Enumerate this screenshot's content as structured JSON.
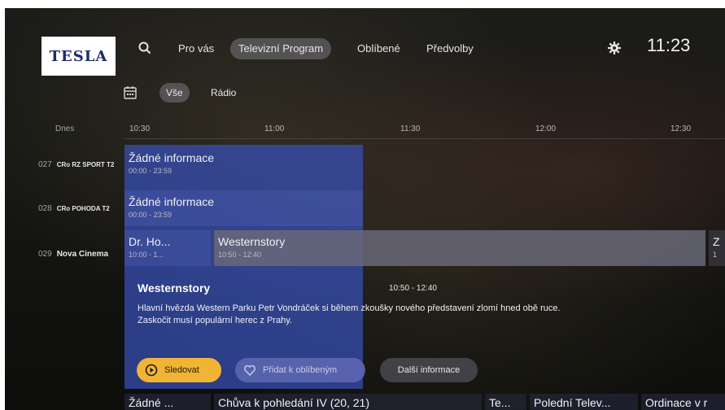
{
  "brand": {
    "logo_text": "TESLA",
    "color": "#1d2a6b"
  },
  "nav": {
    "items": [
      {
        "label": "Pro vás",
        "active": false
      },
      {
        "label": "Televizní Program",
        "active": true
      },
      {
        "label": "Oblíbené",
        "active": false
      },
      {
        "label": "Předvolby",
        "active": false
      }
    ]
  },
  "clock": "11:23",
  "filters": [
    {
      "label": "Vše",
      "active": true
    },
    {
      "label": "Rádio",
      "active": false
    }
  ],
  "timeline": {
    "day_label": "Dnes",
    "times": [
      "10:30",
      "11:00",
      "11:30",
      "12:00",
      "12:30"
    ]
  },
  "channels": [
    {
      "number": "027",
      "name": "CRo RZ SPORT T2",
      "programs": [
        {
          "title": "Žádné informace",
          "time": "00:00 - 23:59"
        }
      ]
    },
    {
      "number": "028",
      "name": "CRo POHODA T2",
      "programs": [
        {
          "title": "Žádné informace",
          "time": "00:00 - 23:59"
        }
      ]
    },
    {
      "number": "029",
      "name": "Nova Cinema",
      "programs": [
        {
          "title": "Dr. Ho...",
          "time": "10:00 - 1..."
        },
        {
          "title": "Westernstory",
          "time": "10:50 - 12:40"
        },
        {
          "title": "Z",
          "time": "1"
        }
      ]
    }
  ],
  "detail": {
    "title": "Westernstory",
    "time": "10:50 - 12:40",
    "description": "Hlavní hvězda Western Parku Petr Vondráček si během zkoušky nového představení zlomí hned obě ruce. Zaskočit musí populární herec z Prahy."
  },
  "actions": {
    "watch": "Sledovat",
    "favorite": "Přidat k oblíbeným",
    "more_info": "Další informace"
  },
  "next_row": {
    "programs": [
      "Žádné ...",
      "Chůva k pohledání IV (20, 21)",
      "Te...",
      "Polední Telev...",
      "Ordinace v r"
    ]
  },
  "colors": {
    "accent": "#f2b434",
    "focus": "#3750b9"
  }
}
